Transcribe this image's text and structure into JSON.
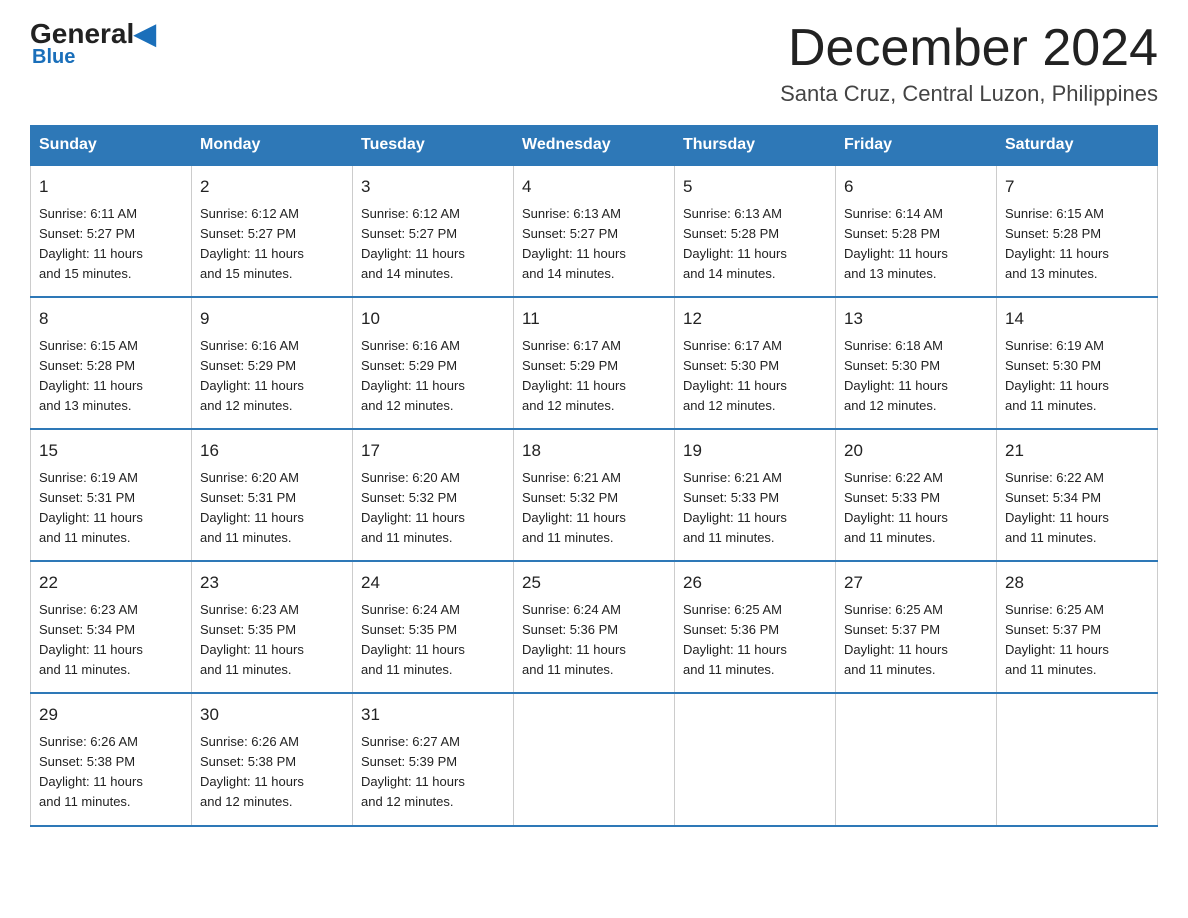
{
  "header": {
    "logo_general": "General",
    "logo_blue": "Blue",
    "month_title": "December 2024",
    "location": "Santa Cruz, Central Luzon, Philippines"
  },
  "weekdays": [
    "Sunday",
    "Monday",
    "Tuesday",
    "Wednesday",
    "Thursday",
    "Friday",
    "Saturday"
  ],
  "weeks": [
    [
      {
        "day": "1",
        "sunrise": "6:11 AM",
        "sunset": "5:27 PM",
        "daylight": "11 hours and 15 minutes."
      },
      {
        "day": "2",
        "sunrise": "6:12 AM",
        "sunset": "5:27 PM",
        "daylight": "11 hours and 15 minutes."
      },
      {
        "day": "3",
        "sunrise": "6:12 AM",
        "sunset": "5:27 PM",
        "daylight": "11 hours and 14 minutes."
      },
      {
        "day": "4",
        "sunrise": "6:13 AM",
        "sunset": "5:27 PM",
        "daylight": "11 hours and 14 minutes."
      },
      {
        "day": "5",
        "sunrise": "6:13 AM",
        "sunset": "5:28 PM",
        "daylight": "11 hours and 14 minutes."
      },
      {
        "day": "6",
        "sunrise": "6:14 AM",
        "sunset": "5:28 PM",
        "daylight": "11 hours and 13 minutes."
      },
      {
        "day": "7",
        "sunrise": "6:15 AM",
        "sunset": "5:28 PM",
        "daylight": "11 hours and 13 minutes."
      }
    ],
    [
      {
        "day": "8",
        "sunrise": "6:15 AM",
        "sunset": "5:28 PM",
        "daylight": "11 hours and 13 minutes."
      },
      {
        "day": "9",
        "sunrise": "6:16 AM",
        "sunset": "5:29 PM",
        "daylight": "11 hours and 12 minutes."
      },
      {
        "day": "10",
        "sunrise": "6:16 AM",
        "sunset": "5:29 PM",
        "daylight": "11 hours and 12 minutes."
      },
      {
        "day": "11",
        "sunrise": "6:17 AM",
        "sunset": "5:29 PM",
        "daylight": "11 hours and 12 minutes."
      },
      {
        "day": "12",
        "sunrise": "6:17 AM",
        "sunset": "5:30 PM",
        "daylight": "11 hours and 12 minutes."
      },
      {
        "day": "13",
        "sunrise": "6:18 AM",
        "sunset": "5:30 PM",
        "daylight": "11 hours and 12 minutes."
      },
      {
        "day": "14",
        "sunrise": "6:19 AM",
        "sunset": "5:30 PM",
        "daylight": "11 hours and 11 minutes."
      }
    ],
    [
      {
        "day": "15",
        "sunrise": "6:19 AM",
        "sunset": "5:31 PM",
        "daylight": "11 hours and 11 minutes."
      },
      {
        "day": "16",
        "sunrise": "6:20 AM",
        "sunset": "5:31 PM",
        "daylight": "11 hours and 11 minutes."
      },
      {
        "day": "17",
        "sunrise": "6:20 AM",
        "sunset": "5:32 PM",
        "daylight": "11 hours and 11 minutes."
      },
      {
        "day": "18",
        "sunrise": "6:21 AM",
        "sunset": "5:32 PM",
        "daylight": "11 hours and 11 minutes."
      },
      {
        "day": "19",
        "sunrise": "6:21 AM",
        "sunset": "5:33 PM",
        "daylight": "11 hours and 11 minutes."
      },
      {
        "day": "20",
        "sunrise": "6:22 AM",
        "sunset": "5:33 PM",
        "daylight": "11 hours and 11 minutes."
      },
      {
        "day": "21",
        "sunrise": "6:22 AM",
        "sunset": "5:34 PM",
        "daylight": "11 hours and 11 minutes."
      }
    ],
    [
      {
        "day": "22",
        "sunrise": "6:23 AM",
        "sunset": "5:34 PM",
        "daylight": "11 hours and 11 minutes."
      },
      {
        "day": "23",
        "sunrise": "6:23 AM",
        "sunset": "5:35 PM",
        "daylight": "11 hours and 11 minutes."
      },
      {
        "day": "24",
        "sunrise": "6:24 AM",
        "sunset": "5:35 PM",
        "daylight": "11 hours and 11 minutes."
      },
      {
        "day": "25",
        "sunrise": "6:24 AM",
        "sunset": "5:36 PM",
        "daylight": "11 hours and 11 minutes."
      },
      {
        "day": "26",
        "sunrise": "6:25 AM",
        "sunset": "5:36 PM",
        "daylight": "11 hours and 11 minutes."
      },
      {
        "day": "27",
        "sunrise": "6:25 AM",
        "sunset": "5:37 PM",
        "daylight": "11 hours and 11 minutes."
      },
      {
        "day": "28",
        "sunrise": "6:25 AM",
        "sunset": "5:37 PM",
        "daylight": "11 hours and 11 minutes."
      }
    ],
    [
      {
        "day": "29",
        "sunrise": "6:26 AM",
        "sunset": "5:38 PM",
        "daylight": "11 hours and 11 minutes."
      },
      {
        "day": "30",
        "sunrise": "6:26 AM",
        "sunset": "5:38 PM",
        "daylight": "11 hours and 12 minutes."
      },
      {
        "day": "31",
        "sunrise": "6:27 AM",
        "sunset": "5:39 PM",
        "daylight": "11 hours and 12 minutes."
      },
      null,
      null,
      null,
      null
    ]
  ],
  "labels": {
    "sunrise": "Sunrise:",
    "sunset": "Sunset:",
    "daylight": "Daylight:"
  }
}
